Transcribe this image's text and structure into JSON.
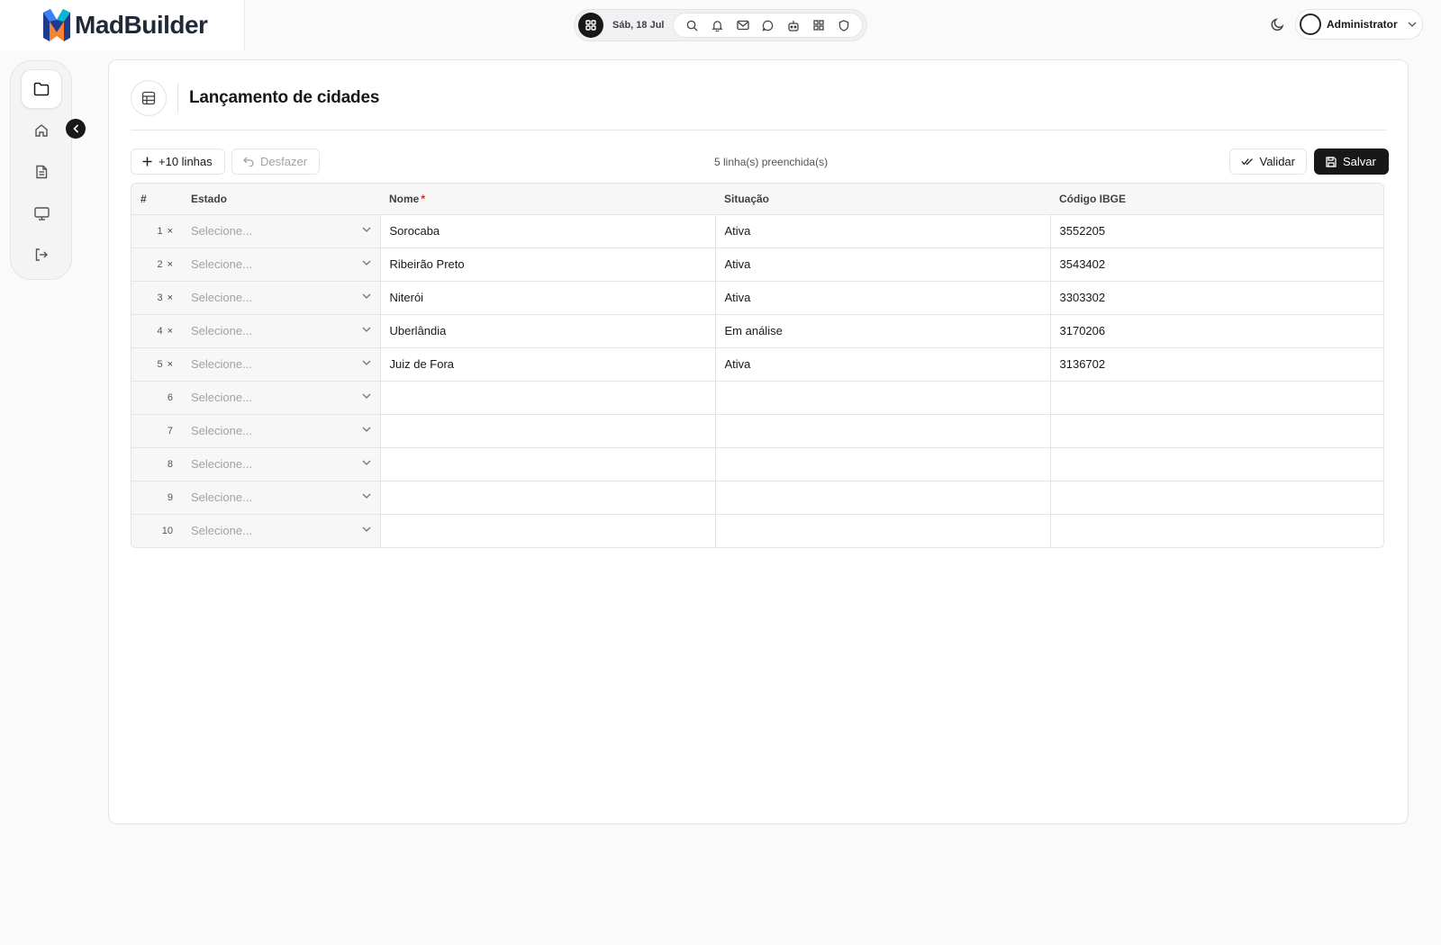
{
  "header": {
    "brand": "MadBuilder",
    "date": "Sáb, 18 Jul",
    "icons": [
      "search-icon",
      "bell-icon",
      "mail-icon",
      "chat-icon",
      "bot-icon",
      "apps-icon",
      "shield-icon"
    ],
    "theme_icon": "moon-icon",
    "user": "Administrator"
  },
  "sidebar": {
    "items": [
      {
        "name": "folder-icon",
        "active": true
      },
      {
        "name": "home-icon",
        "active": false
      },
      {
        "name": "document-icon",
        "active": false
      },
      {
        "name": "monitor-icon",
        "active": false
      },
      {
        "name": "logout-icon",
        "active": false
      }
    ]
  },
  "page": {
    "title": "Lançamento de cidades",
    "toolbar": {
      "add_rows": "+10 linhas",
      "undo": "Desfazer",
      "filled_count": "5 linha(s) preenchida(s)",
      "validate": "Validar",
      "save": "Salvar"
    },
    "table": {
      "columns": [
        "#",
        "Estado",
        "Nome",
        "Situação",
        "Código IBGE"
      ],
      "required_mark": "*",
      "select_placeholder": "Selecione...",
      "remove_glyph": "×",
      "rows": [
        {
          "n": "1",
          "estado": "Selecione...",
          "nome": "Sorocaba",
          "situacao": "Ativa",
          "ibge": "3552205",
          "removable": true
        },
        {
          "n": "2",
          "estado": "Selecione...",
          "nome": "Ribeirão Preto",
          "situacao": "Ativa",
          "ibge": "3543402",
          "removable": true
        },
        {
          "n": "3",
          "estado": "Selecione...",
          "nome": "Niterói",
          "situacao": "Ativa",
          "ibge": "3303302",
          "removable": true
        },
        {
          "n": "4",
          "estado": "Selecione...",
          "nome": "Uberlândia",
          "situacao": "Em análise",
          "ibge": "3170206",
          "removable": true
        },
        {
          "n": "5",
          "estado": "Selecione...",
          "nome": "Juiz de Fora",
          "situacao": "Ativa",
          "ibge": "3136702",
          "removable": true
        },
        {
          "n": "6",
          "estado": "Selecione...",
          "nome": "",
          "situacao": "",
          "ibge": "",
          "removable": false
        },
        {
          "n": "7",
          "estado": "Selecione...",
          "nome": "",
          "situacao": "",
          "ibge": "",
          "removable": false
        },
        {
          "n": "8",
          "estado": "Selecione...",
          "nome": "",
          "situacao": "",
          "ibge": "",
          "removable": false
        },
        {
          "n": "9",
          "estado": "Selecione...",
          "nome": "",
          "situacao": "",
          "ibge": "",
          "removable": false
        },
        {
          "n": "10",
          "estado": "Selecione...",
          "nome": "",
          "situacao": "",
          "ibge": "",
          "removable": false
        }
      ]
    }
  }
}
